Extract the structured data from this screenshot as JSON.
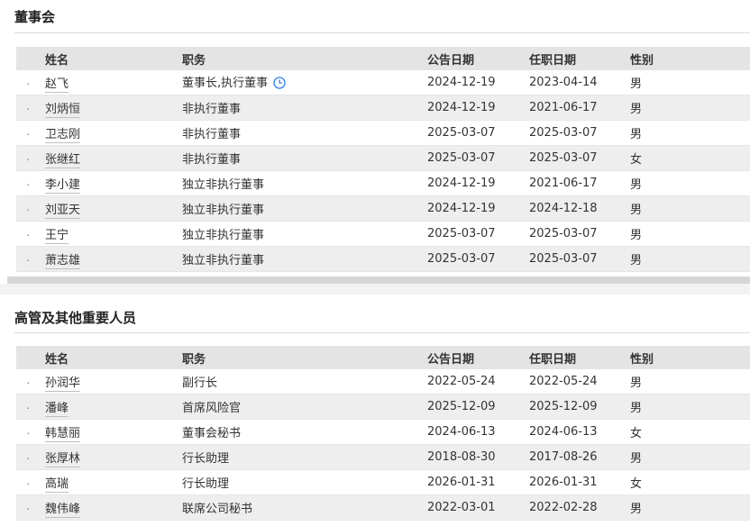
{
  "board": {
    "title": "董事会",
    "headers": {
      "name": "姓名",
      "post": "职务",
      "announce": "公告日期",
      "start": "任职日期",
      "sex": "性别"
    },
    "rows": [
      {
        "name": "赵飞",
        "post": "董事长,执行董事",
        "announce": "2024-12-19",
        "start": "2023-04-14",
        "sex": "男"
      },
      {
        "name": "刘炳恒",
        "post": "非执行董事",
        "announce": "2024-12-19",
        "start": "2021-06-17",
        "sex": "男"
      },
      {
        "name": "卫志刚",
        "post": "非执行董事",
        "announce": "2025-03-07",
        "start": "2025-03-07",
        "sex": "男"
      },
      {
        "name": "张继红",
        "post": "非执行董事",
        "announce": "2025-03-07",
        "start": "2025-03-07",
        "sex": "女"
      },
      {
        "name": "李小建",
        "post": "独立非执行董事",
        "announce": "2024-12-19",
        "start": "2021-06-17",
        "sex": "男"
      },
      {
        "name": "刘亚天",
        "post": "独立非执行董事",
        "announce": "2024-12-19",
        "start": "2024-12-18",
        "sex": "男"
      },
      {
        "name": "王宁",
        "post": "独立非执行董事",
        "announce": "2025-03-07",
        "start": "2025-03-07",
        "sex": "男"
      },
      {
        "name": "萧志雄",
        "post": "独立非执行董事",
        "announce": "2025-03-07",
        "start": "2025-03-07",
        "sex": "男"
      }
    ]
  },
  "executives": {
    "title": "高管及其他重要人员",
    "headers": {
      "name": "姓名",
      "post": "职务",
      "announce": "公告日期",
      "start": "任职日期",
      "sex": "性别"
    },
    "rows": [
      {
        "name": "孙润华",
        "post": "副行长",
        "announce": "2022-05-24",
        "start": "2022-05-24",
        "sex": "男"
      },
      {
        "name": "潘峰",
        "post": "首席风险官",
        "announce": "2025-12-09",
        "start": "2025-12-09",
        "sex": "男"
      },
      {
        "name": "韩慧丽",
        "post": "董事会秘书",
        "announce": "2024-06-13",
        "start": "2024-06-13",
        "sex": "女"
      },
      {
        "name": "张厚林",
        "post": "行长助理",
        "announce": "2018-08-30",
        "start": "2017-08-26",
        "sex": "男"
      },
      {
        "name": "高瑞",
        "post": "行长助理",
        "announce": "2026-01-31",
        "start": "2026-01-31",
        "sex": "女"
      },
      {
        "name": "魏伟峰",
        "post": "联席公司秘书",
        "announce": "2022-03-01",
        "start": "2022-02-28",
        "sex": "男"
      }
    ]
  },
  "icons": {
    "clock": "clock-icon",
    "expand": "triangle-expand-icon"
  },
  "colors": {
    "clock": "#2f80ed",
    "header_bg": "#e4e4e4",
    "row_alt": "#eeeeee"
  }
}
